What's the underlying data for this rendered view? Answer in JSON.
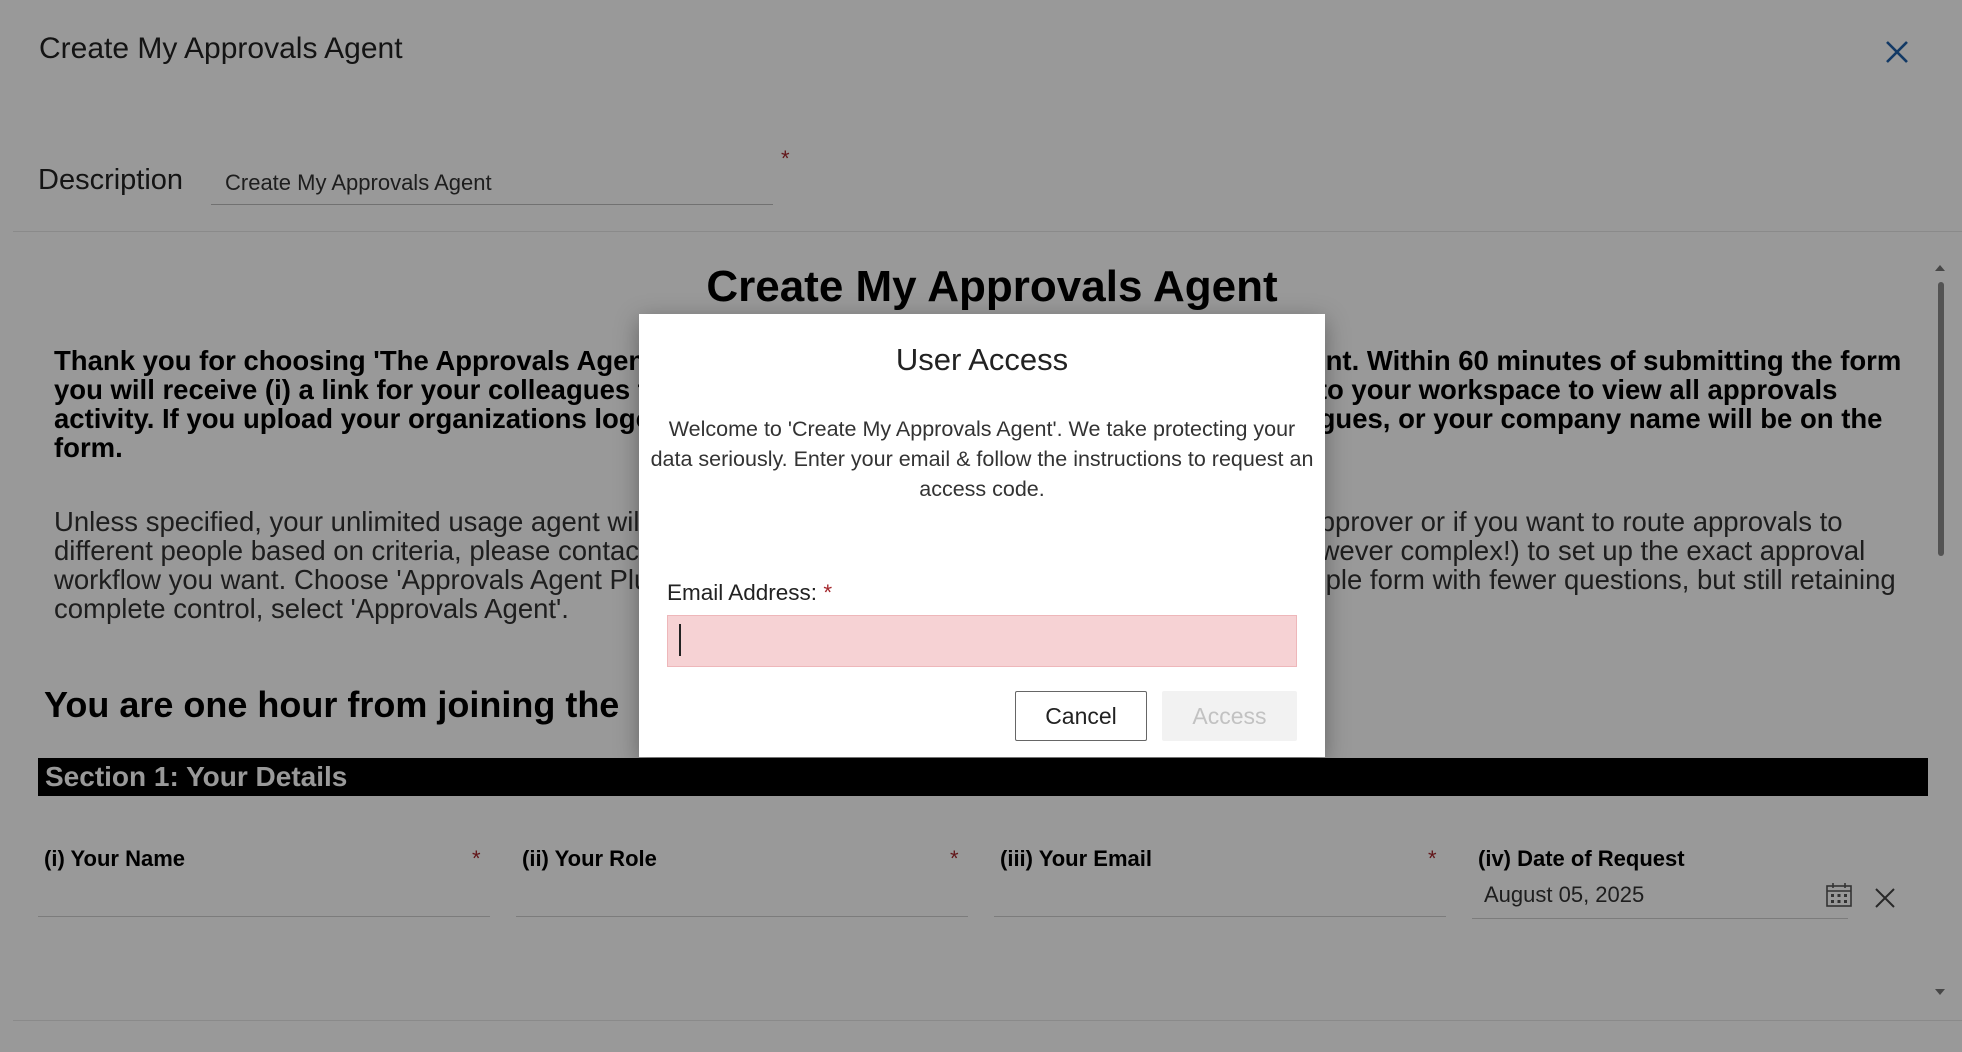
{
  "panel": {
    "title": "Create My Approvals Agent",
    "description_label": "Description",
    "description_value": "Create My Approvals Agent",
    "required_mark": "*"
  },
  "form": {
    "title": "Create My Approvals Agent",
    "intro_bold": "Thank you for choosing 'The Approvals Agent'. This form will be used to create your branded agent. Within 60 minutes of submitting the form you will receive (i) a link for your colleagues to take control of all your approvals; and (ii) access to your workspace to view all approvals activity. If you upload your organizations logo this will be shown on the form used by your colleagues, or your company name will be on the form.",
    "intro_normal": "Unless specified, your unlimited usage agent will route all approvals to you. If you need more than one approver or if you want to route approvals to different people based on criteria, please contact us via hello@ask.kim to discuss your requriements (however complex!) to set up the exact approval workflow you want. Choose 'Approvals Agent Plus' if you want more detailed data and reporting, or a simple form with fewer questions, but still retaining complete control, select 'Approvals Agent'.",
    "hour_heading": "You are one hour from joining the",
    "section_title": "Section 1: Your Details",
    "fields": [
      {
        "label": "(i) Your Name",
        "required": "*"
      },
      {
        "label": "(ii) Your Role",
        "required": "*"
      },
      {
        "label": "(iii) Your Email",
        "required": "*"
      },
      {
        "label": "(iv) Date of Request",
        "value": "August 05, 2025"
      }
    ]
  },
  "modal": {
    "title": "User Access",
    "message": "Welcome to 'Create My Approvals Agent'. We take protecting your data seriously. Enter your email & follow the instructions to request an access code.",
    "email_label": "Email Address:",
    "email_required": "*",
    "email_value": "",
    "cancel_label": "Cancel",
    "access_label": "Access"
  },
  "colors": {
    "overlay": "#000000",
    "input_error_bg": "#f6d2d4",
    "required": "#a4262c",
    "link_blue": "#1f5fa8",
    "section_bar": "#000000"
  },
  "icons": [
    "close-icon",
    "calendar-icon",
    "clear-icon",
    "scroll-up-icon",
    "scroll-down-icon"
  ]
}
